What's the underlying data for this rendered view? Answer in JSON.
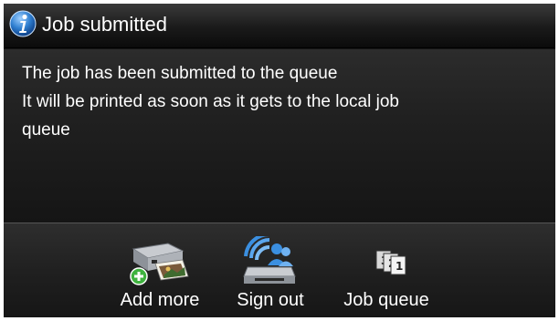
{
  "dialog": {
    "title": "Job submitted",
    "title_icon": "info-icon",
    "message_lines": [
      "The job has been submitted to the queue",
      "It will be printed as soon as it gets to the local job",
      "queue"
    ]
  },
  "footer": {
    "actions": [
      {
        "label": "Add more",
        "icon": "printer-add-icon"
      },
      {
        "label": "Sign out",
        "icon": "sign-out-icon"
      },
      {
        "label": "Job queue",
        "icon": "job-queue-icon"
      }
    ]
  },
  "colors": {
    "info_accent": "#2f7fd0",
    "plus_green": "#3fb23f",
    "user_blue": "#3b8fe0"
  }
}
